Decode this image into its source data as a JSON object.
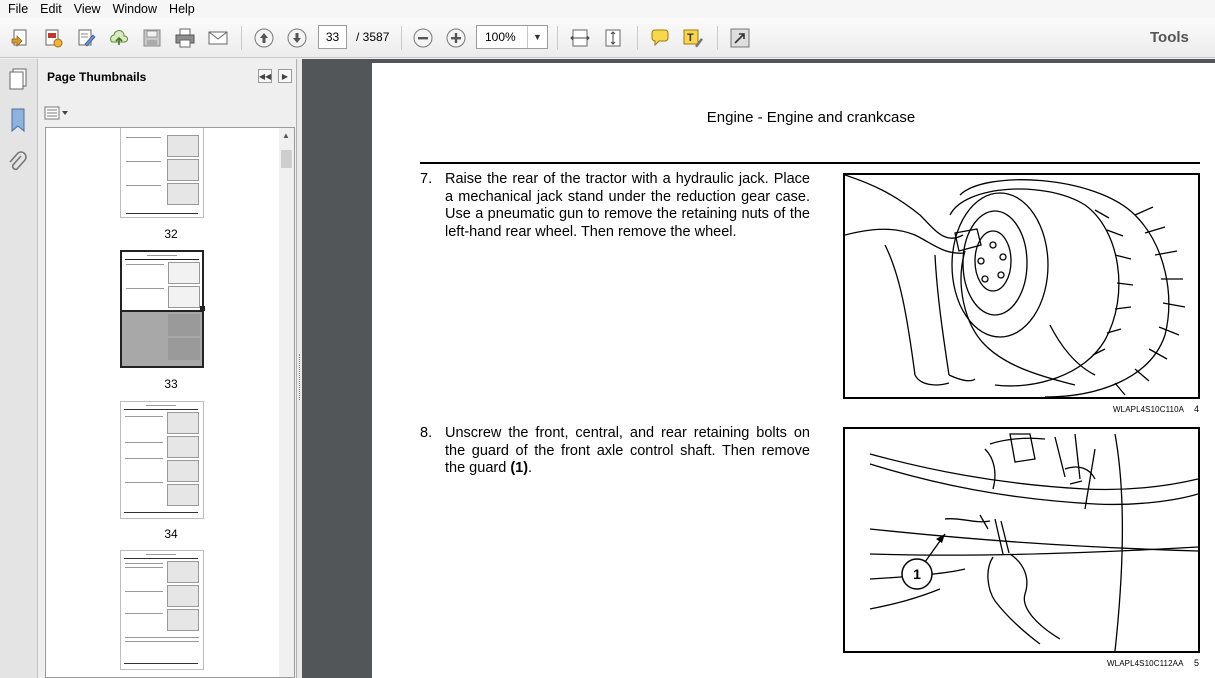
{
  "menu": [
    "File",
    "Edit",
    "View",
    "Window",
    "Help"
  ],
  "toolbar": {
    "current_page": "33",
    "total_pages": "/ 3587",
    "zoom": "100%",
    "tools_label": "Tools"
  },
  "icons": [
    "create-icon",
    "convert-icon",
    "edit-icon",
    "upload-icon",
    "save-icon",
    "print-icon",
    "email-icon",
    "previous-page-icon",
    "next-page-icon",
    "zoom-out-icon",
    "zoom-in-icon",
    "fit-width-icon",
    "fit-page-icon",
    "comment-icon",
    "highlight-text-icon",
    "full-screen-icon"
  ],
  "panel": {
    "title": "Page Thumbnails",
    "thumbnails": [
      {
        "label": "32"
      },
      {
        "label": "33"
      },
      {
        "label": "34"
      },
      {
        "label": ""
      }
    ]
  },
  "document": {
    "header": "Engine - Engine and crankcase",
    "steps": [
      {
        "number": "7.",
        "text": "Raise the rear of the tractor with a hydraulic jack. Place a mechanical jack stand under the reduction gear case. Use a pneumatic gun to remove the retaining nuts of the left-hand rear wheel. Then remove the wheel.",
        "figure_code": "WLAPL4S10C110A",
        "figure_number": "4"
      },
      {
        "number": "8.",
        "text_before": "Unscrew the front, central, and rear retaining bolts on the guard of the front axle control shaft. Then remove the guard ",
        "text_bold": "(1)",
        "text_after": ".",
        "figure_code": "WLAPL4S10C112AA",
        "figure_number": "5",
        "callout": "1"
      }
    ]
  }
}
